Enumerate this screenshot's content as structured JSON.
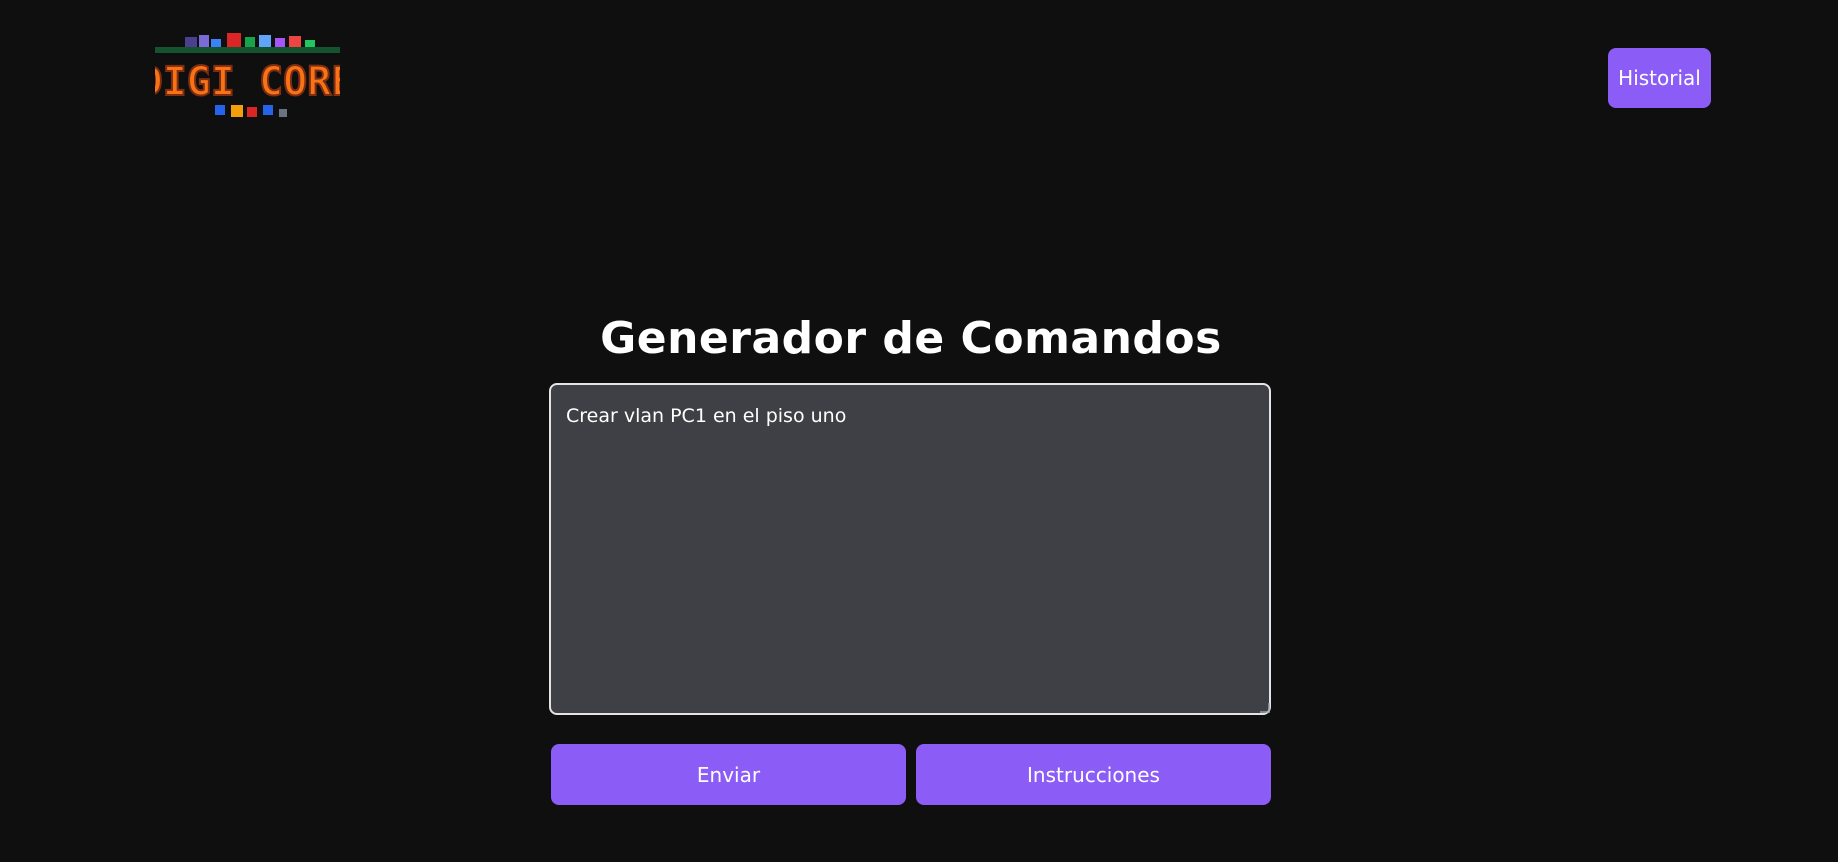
{
  "header": {
    "logo_text": "DIGI CORE",
    "history_label": "Historial"
  },
  "main": {
    "title": "Generador de Comandos",
    "prompt_value": "Crear vlan PC1 en el piso uno",
    "send_label": "Enviar",
    "instructions_label": "Instrucciones"
  },
  "colors": {
    "background": "#0f0f10",
    "accent": "#8b5cf6",
    "textarea_bg": "#3f3f46"
  }
}
